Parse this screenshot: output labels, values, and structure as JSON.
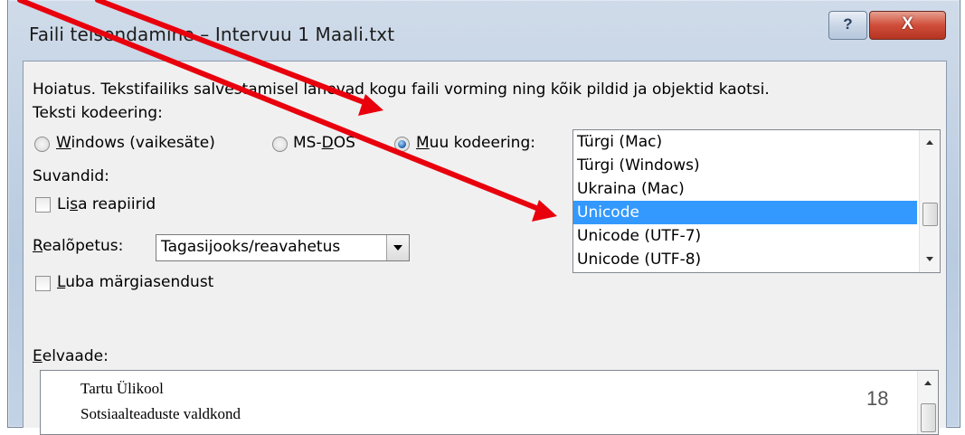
{
  "window": {
    "title": "Faili teisendamine – Intervuu 1 Maali.txt",
    "help_glyph": "?",
    "close_glyph": "X"
  },
  "warning_text": "Hoiatus. Tekstifailiks salvestamisel lähevad kogu faili vorming ning kõik pildid ja objektid kaotsi.",
  "encoding": {
    "label": "Teksti kodeering:",
    "options": [
      {
        "pre": "",
        "key": "W",
        "post": "indows (vaikesäte)",
        "checked": false
      },
      {
        "pre": "MS-",
        "key": "D",
        "post": "OS",
        "checked": false
      },
      {
        "pre": "",
        "key": "M",
        "post": "uu kodeering:",
        "checked": true
      }
    ],
    "list_items": [
      "Türgi (Mac)",
      "Türgi (Windows)",
      "Ukraina (Mac)",
      "Unicode",
      "Unicode (UTF-7)",
      "Unicode (UTF-8)"
    ],
    "selected_item": "Unicode"
  },
  "options": {
    "label": "Suvandid:",
    "insert_breaks": {
      "pre": "Li",
      "key": "s",
      "post": "a reapiirid",
      "checked": false
    },
    "line_end": {
      "key": "R",
      "post": "ealõpetus:",
      "value": "Tagasijooks/reavahetus"
    },
    "allow_substitution": {
      "pre": "",
      "key": "L",
      "post": "uba märgiasendust",
      "checked": false
    }
  },
  "preview": {
    "key": "E",
    "post": "elvaade:",
    "lines": [
      "Tartu Ülikool",
      "Sotsiaalteaduste valdkond"
    ]
  },
  "slide_number": "18",
  "colors": {
    "annotation_arrow": "#e8000d",
    "selection": "#3399ff"
  }
}
